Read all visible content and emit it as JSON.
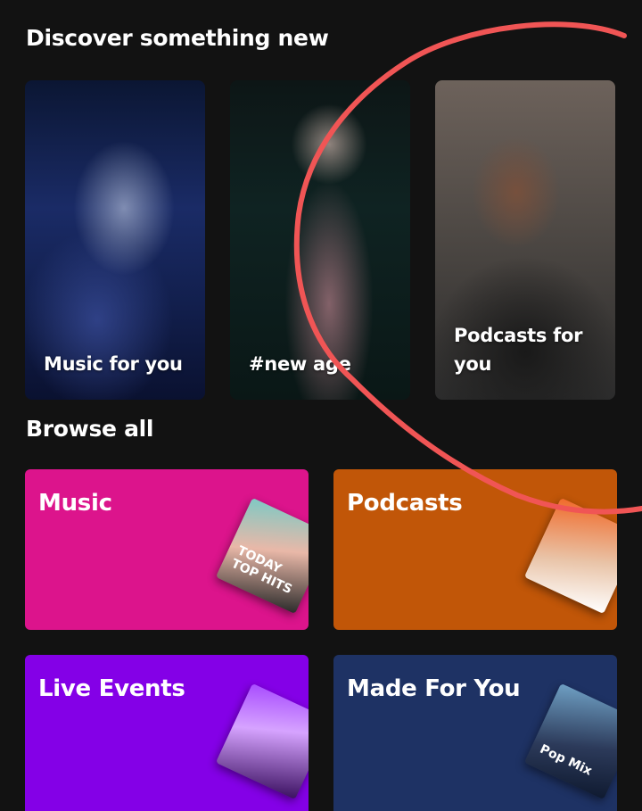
{
  "discover": {
    "title": "Discover something new",
    "cards": [
      {
        "label": "Music for you"
      },
      {
        "label": "#new age"
      },
      {
        "label": "Podcasts for you"
      }
    ]
  },
  "browse": {
    "title": "Browse all",
    "tiles": [
      {
        "label": "Music",
        "color": "#dc148c",
        "art_text": "TODAY TOP HITS"
      },
      {
        "label": "Podcasts",
        "color": "#c15608",
        "art_text": ""
      },
      {
        "label": "Live Events",
        "color": "#8400e7",
        "art_text": ""
      },
      {
        "label": "Made For You",
        "color": "#1e3264",
        "art_text": "Pop Mix"
      }
    ]
  },
  "colors": {
    "background": "#121212",
    "annotation_stroke": "#f05555"
  }
}
